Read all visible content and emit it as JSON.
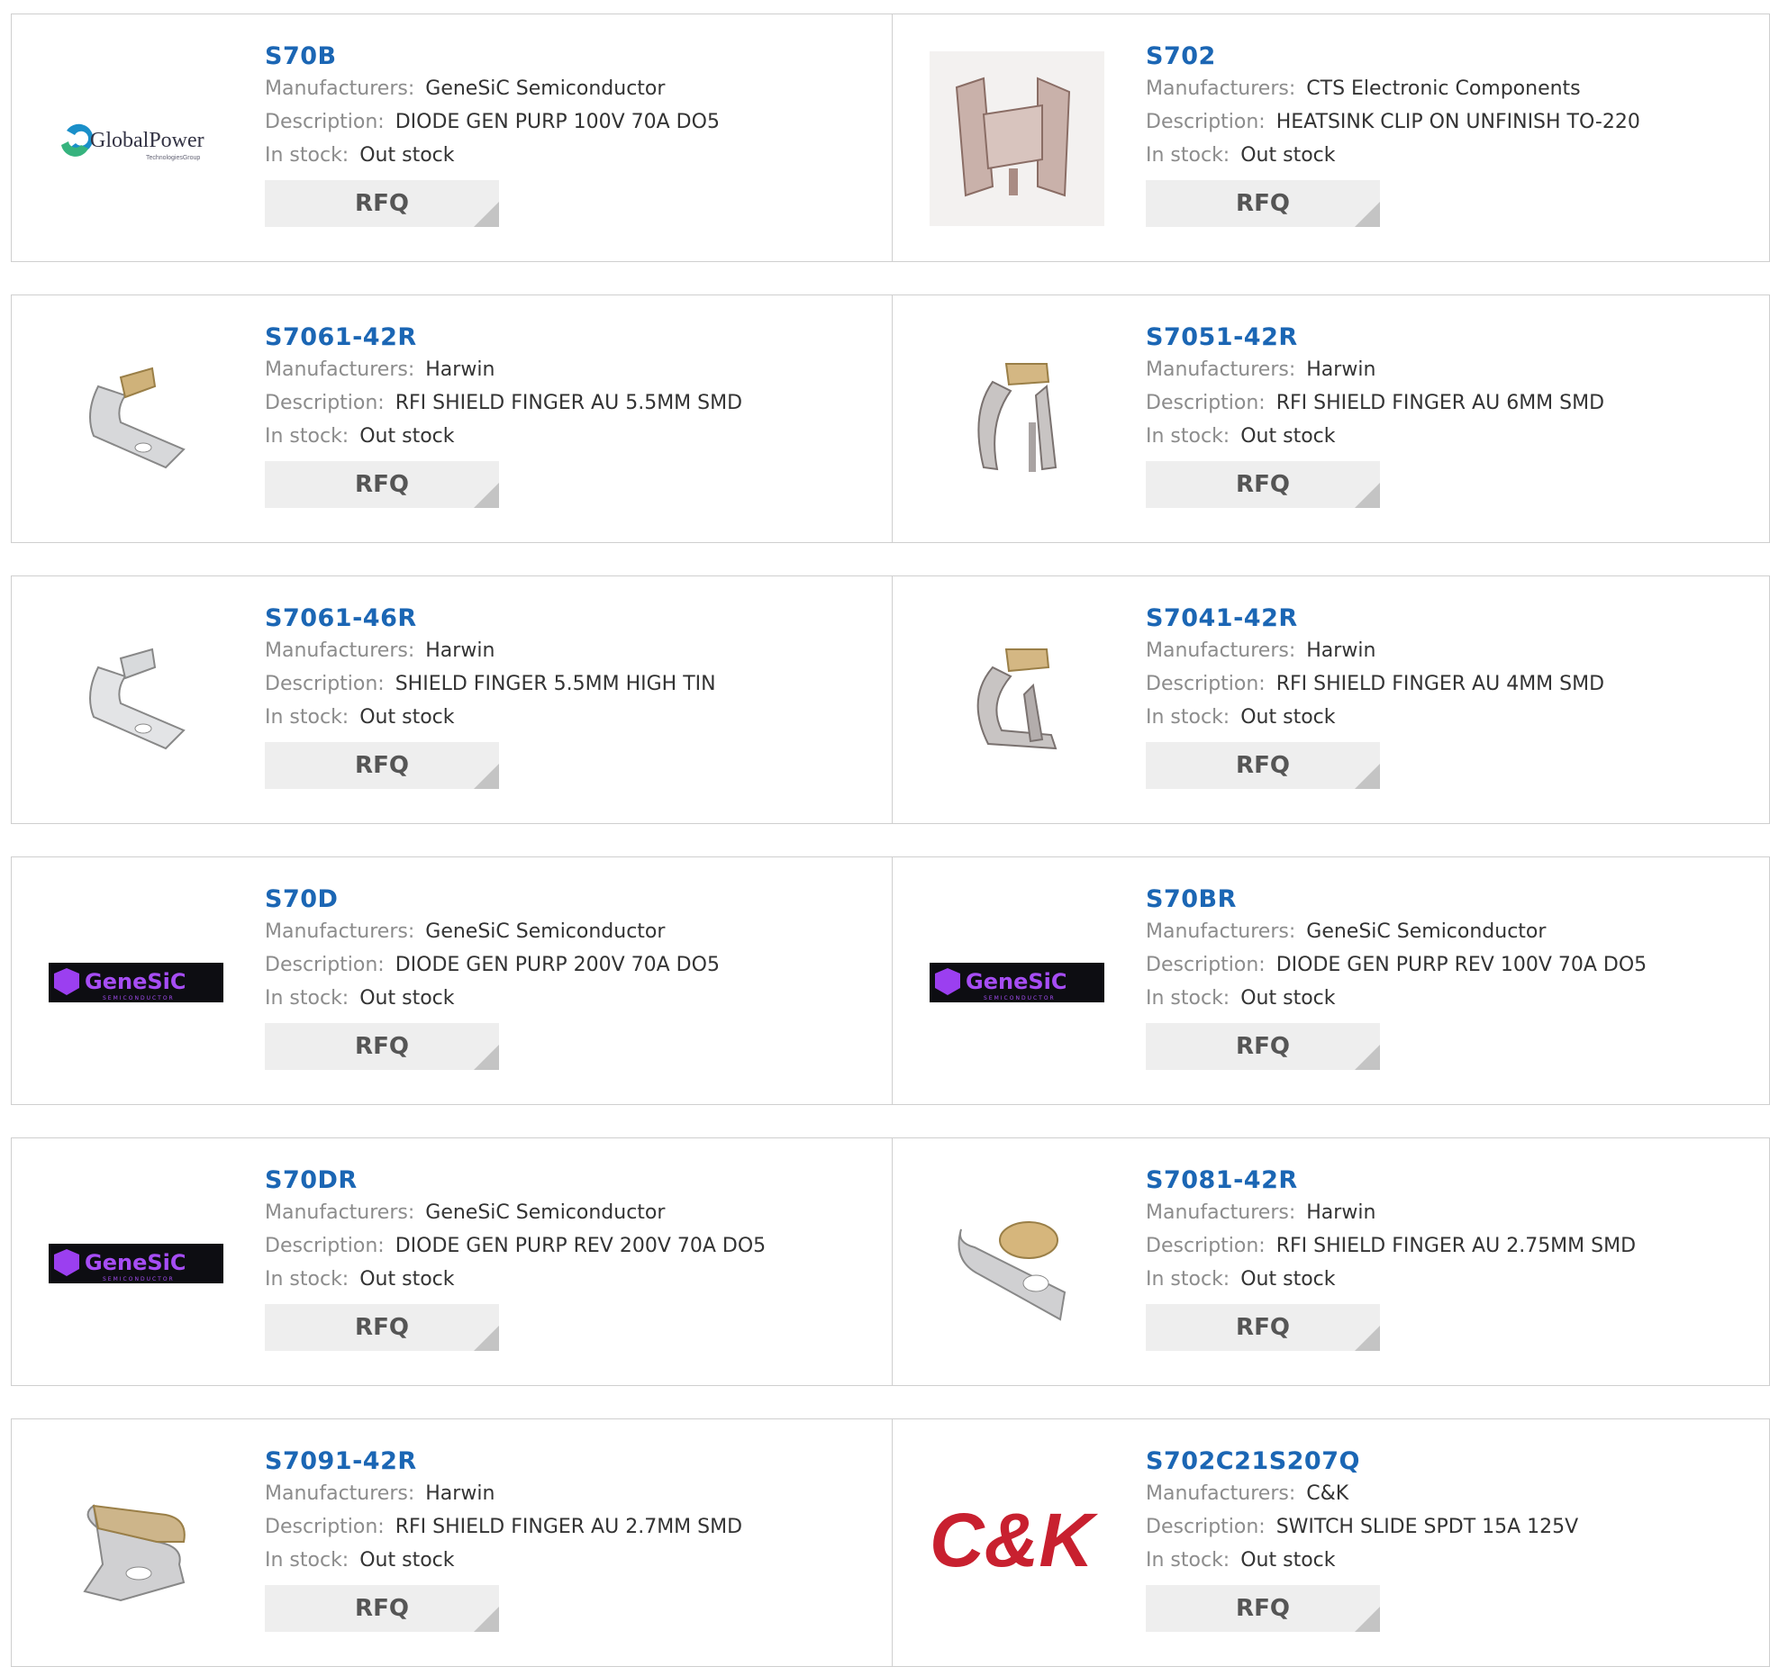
{
  "labels": {
    "manufacturers": "Manufacturers:",
    "description": "Description:",
    "in_stock": "In stock:",
    "rfq": "RFQ"
  },
  "logos": {
    "globalpower_name": "GlobalPower",
    "globalpower_sub": "TechnologiesGroup",
    "genesic_name": "GeneSiC",
    "genesic_sub": "SEMICONDUCTOR",
    "ck_name": "C&K"
  },
  "items": [
    {
      "part": "S70B",
      "manufacturer": "GeneSiC Semiconductor",
      "description": "DIODE GEN PURP 100V 70A DO5",
      "stock": "Out stock",
      "image": "globalpower-logo"
    },
    {
      "part": "S702",
      "manufacturer": "CTS Electronic Components",
      "description": "HEATSINK CLIP ON UNFINISH TO-220",
      "stock": "Out stock",
      "image": "heatsink-clip-photo"
    },
    {
      "part": "S7061-42R",
      "manufacturer": "Harwin",
      "description": "RFI SHIELD FINGER AU 5.5MM SMD",
      "stock": "Out stock",
      "image": "shield-finger-photo"
    },
    {
      "part": "S7051-42R",
      "manufacturer": "Harwin",
      "description": "RFI SHIELD FINGER AU 6MM SMD",
      "stock": "Out stock",
      "image": "shield-finger-photo"
    },
    {
      "part": "S7061-46R",
      "manufacturer": "Harwin",
      "description": "SHIELD FINGER 5.5MM HIGH TIN",
      "stock": "Out stock",
      "image": "shield-finger-photo"
    },
    {
      "part": "S7041-42R",
      "manufacturer": "Harwin",
      "description": "RFI SHIELD FINGER AU 4MM SMD",
      "stock": "Out stock",
      "image": "shield-finger-photo"
    },
    {
      "part": "S70D",
      "manufacturer": "GeneSiC Semiconductor",
      "description": "DIODE GEN PURP 200V 70A DO5",
      "stock": "Out stock",
      "image": "genesic-logo"
    },
    {
      "part": "S70BR",
      "manufacturer": "GeneSiC Semiconductor",
      "description": "DIODE GEN PURP REV 100V 70A DO5",
      "stock": "Out stock",
      "image": "genesic-logo"
    },
    {
      "part": "S70DR",
      "manufacturer": "GeneSiC Semiconductor",
      "description": "DIODE GEN PURP REV 200V 70A DO5",
      "stock": "Out stock",
      "image": "genesic-logo"
    },
    {
      "part": "S7081-42R",
      "manufacturer": "Harwin",
      "description": "RFI SHIELD FINGER AU 2.75MM SMD",
      "stock": "Out stock",
      "image": "shield-finger-photo"
    },
    {
      "part": "S7091-42R",
      "manufacturer": "Harwin",
      "description": "RFI SHIELD FINGER AU 2.7MM SMD",
      "stock": "Out stock",
      "image": "shield-finger-photo"
    },
    {
      "part": "S702C21S207Q",
      "manufacturer": "C&K",
      "description": "SWITCH SLIDE SPDT 15A 125V",
      "stock": "Out stock",
      "image": "ck-logo"
    }
  ]
}
